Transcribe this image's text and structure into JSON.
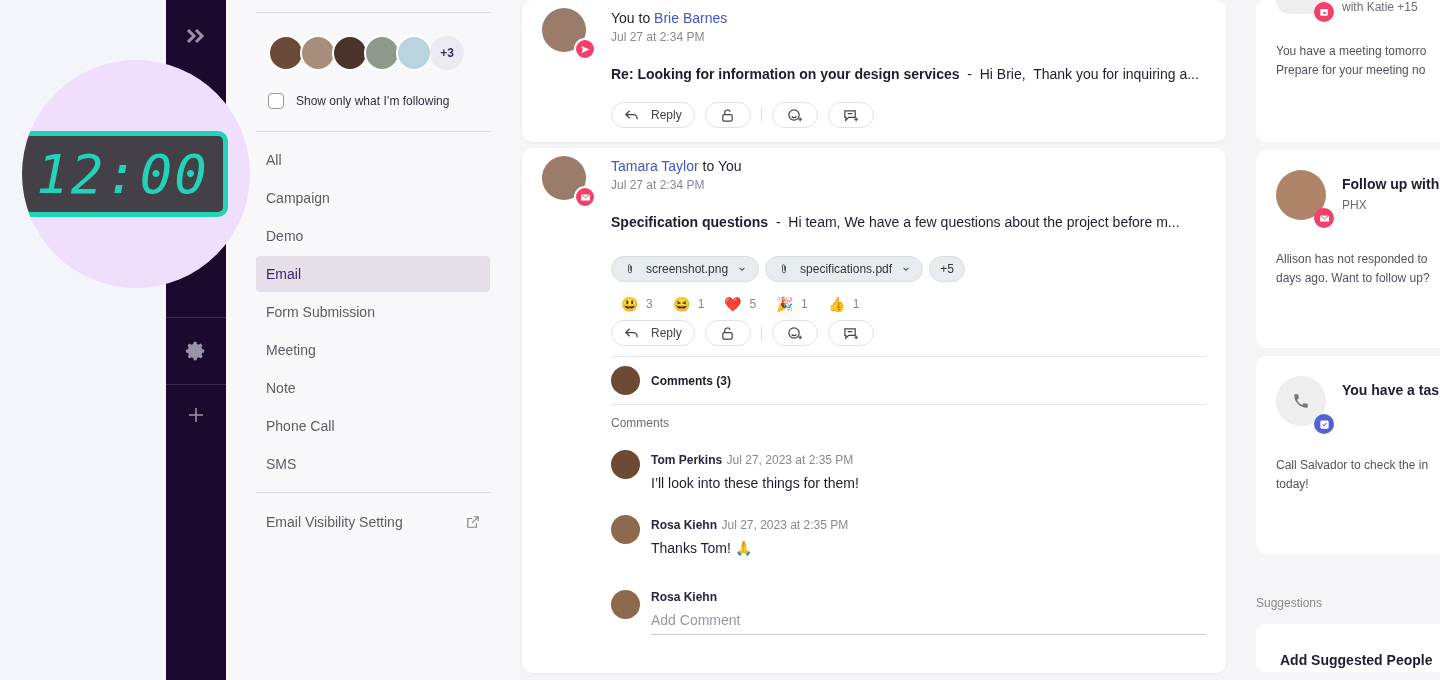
{
  "clock": {
    "time": "12:00"
  },
  "filter": {
    "followers_more": "+3",
    "follow_only": {
      "label": "Show only what I’m following",
      "checked": false
    },
    "types": [
      {
        "label": "All",
        "selected": false
      },
      {
        "label": "Campaign",
        "selected": false
      },
      {
        "label": "Demo",
        "selected": false
      },
      {
        "label": "Email",
        "selected": true
      },
      {
        "label": "Form Submission",
        "selected": false
      },
      {
        "label": "Meeting",
        "selected": false
      },
      {
        "label": "Note",
        "selected": false
      },
      {
        "label": "Phone Call",
        "selected": false
      },
      {
        "label": "SMS",
        "selected": false
      }
    ],
    "visibility_link": "Email Visibility Setting"
  },
  "feed": [
    {
      "kind": "sent",
      "sender": "You",
      "sender_link": false,
      "connector": "to",
      "recipient": "Brie Barnes",
      "recipient_link": true,
      "time": "Jul 27 at 2:34 PM",
      "summary": "**Re: Looking for information on your design services**  -  Hi Brie,  Thank you for inquiring a...",
      "reply": "Reply"
    },
    {
      "kind": "email",
      "sender": "Tamara Taylor",
      "sender_link": true,
      "connector": "to",
      "recipient": "You",
      "recipient_link": false,
      "time": "Jul 27 at 2:34 PM",
      "summary": "**Specification questions**  -  Hi team, We have a few questions about the project before m...",
      "attachments": [
        {
          "name": "screenshot.png"
        },
        {
          "name": "specifications.pdf"
        }
      ],
      "attachments_more": "+5",
      "reactions": [
        {
          "emoji": "😃",
          "count": "3"
        },
        {
          "emoji": "😆",
          "count": "1"
        },
        {
          "emoji": "❤️",
          "count": "5"
        },
        {
          "emoji": "🎉",
          "count": "1"
        },
        {
          "emoji": "👍",
          "count": "1"
        }
      ],
      "reply": "Reply",
      "comments": {
        "summary": "Comments (3)",
        "heading": "Comments",
        "items": [
          {
            "author": "Tom Perkins",
            "time": "Jul 27, 2023 at 2:35 PM",
            "text": "I’ll look into these things for them!"
          },
          {
            "author": "Rosa Kiehn",
            "time": "Jul 27, 2023 at 2:35 PM",
            "text": "Thanks Tom! 🙏"
          }
        ],
        "composer": {
          "author": "Rosa Kiehn",
          "placeholder": "Add Comment"
        }
      }
    }
  ],
  "side_cards": [
    {
      "kind": "meeting",
      "subtitle": "with Katie +15",
      "body": [
        "You have a meeting tomorro",
        "Prepare for your meeting no"
      ]
    },
    {
      "kind": "email",
      "title": "Follow up with",
      "subtitle": "PHX",
      "body": [
        "Allison has not responded to",
        "days ago. Want to follow up?"
      ]
    },
    {
      "kind": "task",
      "title": "You have a tas",
      "body": [
        "Call Salvador to check the in",
        "today!"
      ]
    }
  ],
  "suggestions": {
    "label": "Suggestions",
    "title": "Add Suggested People"
  }
}
